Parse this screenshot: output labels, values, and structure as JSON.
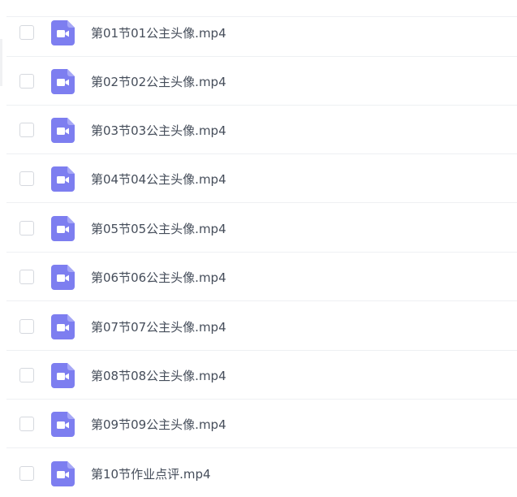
{
  "files": [
    {
      "name": "第01节01公主头像.mp4",
      "icon": "video-file-icon"
    },
    {
      "name": "第02节02公主头像.mp4",
      "icon": "video-file-icon"
    },
    {
      "name": "第03节03公主头像.mp4",
      "icon": "video-file-icon"
    },
    {
      "name": "第04节04公主头像.mp4",
      "icon": "video-file-icon"
    },
    {
      "name": "第05节05公主头像.mp4",
      "icon": "video-file-icon"
    },
    {
      "name": "第06节06公主头像.mp4",
      "icon": "video-file-icon"
    },
    {
      "name": "第07节07公主头像.mp4",
      "icon": "video-file-icon"
    },
    {
      "name": "第08节08公主头像.mp4",
      "icon": "video-file-icon"
    },
    {
      "name": "第09节09公主头像.mp4",
      "icon": "video-file-icon"
    },
    {
      "name": "第10节作业点评.mp4",
      "icon": "video-file-icon"
    }
  ],
  "colors": {
    "icon_bg": "#7d7ef0",
    "text": "#454d5a",
    "divider": "#eef0f3",
    "checkbox_border": "#d5d8de"
  }
}
